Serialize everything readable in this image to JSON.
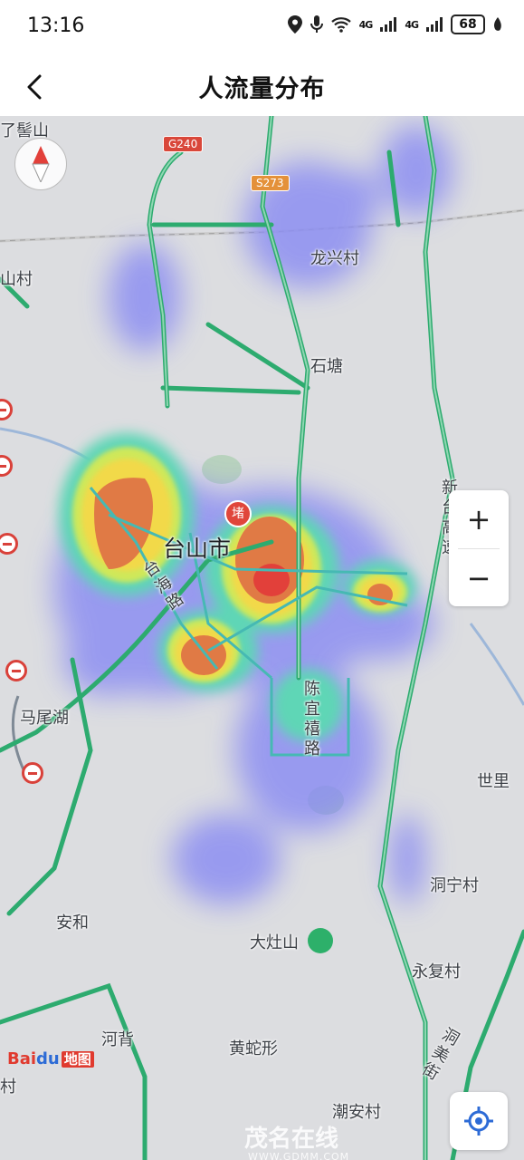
{
  "status_bar": {
    "time": "13:16",
    "signal1": "4G",
    "signal2": "4G",
    "battery": "68"
  },
  "header": {
    "title": "人流量分布"
  },
  "map": {
    "places": {
      "shanguang": "了髻山",
      "shancun": "山村",
      "longxingcun": "龙兴村",
      "shitang": "石塘",
      "taishan_city": "台山市",
      "taihai_road": "台海路",
      "chenyixi_road": "陈宜禧路",
      "xinkai_highway": "新台高速",
      "maweihu": "马尾湖",
      "shili": "世里",
      "dongningcun": "洞宁村",
      "anhe": "安和",
      "dazaoshan": "大灶山",
      "yongfucun": "永复村",
      "hebei": "河背",
      "huangsheying": "黄蛇形",
      "dongmeijie": "洞美街",
      "chaoancun": "潮安村",
      "cun": "村"
    },
    "shields": {
      "g240": "G240",
      "s273": "S273"
    },
    "poi_pin": "堵",
    "zoom": {
      "in": "+",
      "out": "−"
    },
    "logo": {
      "bai": "Bai",
      "du": "du",
      "ditu": "地图"
    },
    "watermark": {
      "main": "茂名在线",
      "sub": "WWW.GDMM.COM"
    }
  },
  "icons": [
    "back-arrow-icon",
    "compass-icon",
    "locate-icon",
    "location-pin-icon",
    "mic-icon",
    "wifi-icon"
  ],
  "colors": {
    "road": "#2dab6f",
    "heat_low": "#8a8cf0",
    "heat_mid": "#5fd3a0",
    "heat_high": "#f0e24a",
    "heat_peak": "#e0462e"
  }
}
